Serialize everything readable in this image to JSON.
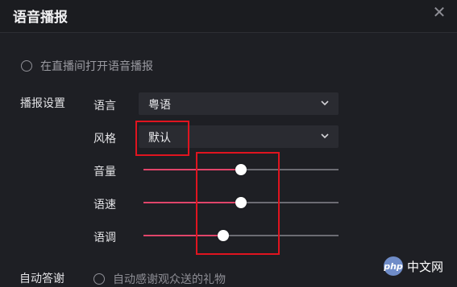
{
  "window": {
    "title": "语音播报",
    "close_glyph": "✕"
  },
  "live_broadcast": {
    "label": "在直播间打开语音播报",
    "checked": false
  },
  "settings": {
    "section_label": "播报设置",
    "language": {
      "label": "语言",
      "value": "粤语"
    },
    "style": {
      "label": "风格",
      "value": "默认"
    },
    "volume": {
      "label": "音量",
      "level": 0.5
    },
    "speed": {
      "label": "语速",
      "level": 0.5
    },
    "pitch": {
      "label": "语调",
      "level": 0.41
    }
  },
  "auto_thanks": {
    "label": "自动答谢",
    "option_label": "自动感谢观众送的礼物"
  },
  "watermark": {
    "logo_text": "php",
    "text": "中文网"
  },
  "colors": {
    "accent": "#e0456a",
    "highlight": "#e0141f",
    "background": "#1e1f24"
  }
}
